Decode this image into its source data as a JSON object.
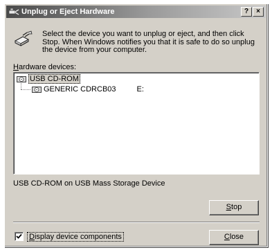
{
  "window": {
    "title": "Unplug or Eject Hardware",
    "help_glyph": "?",
    "close_glyph": "×"
  },
  "instructions": "Select the device you want to unplug or eject, and then click Stop. When Windows notifies you that it is safe to do so unplug the device from your computer.",
  "hardware_label": {
    "mnemonic": "H",
    "rest": "ardware devices:"
  },
  "tree": {
    "root": {
      "label": "USB CD-ROM",
      "icon": "cdrom-icon"
    },
    "child": {
      "label": "GENERIC CDRCB03",
      "drive": "E:",
      "icon": "cdrom-icon"
    }
  },
  "device_description": "USB CD-ROM on USB Mass Storage Device",
  "stop_button": {
    "mnemonic": "S",
    "rest": "top"
  },
  "checkbox": {
    "checked": true,
    "mnemonic": "D",
    "rest": "isplay device components"
  },
  "close_button": {
    "mnemonic": "C",
    "rest": "lose"
  }
}
